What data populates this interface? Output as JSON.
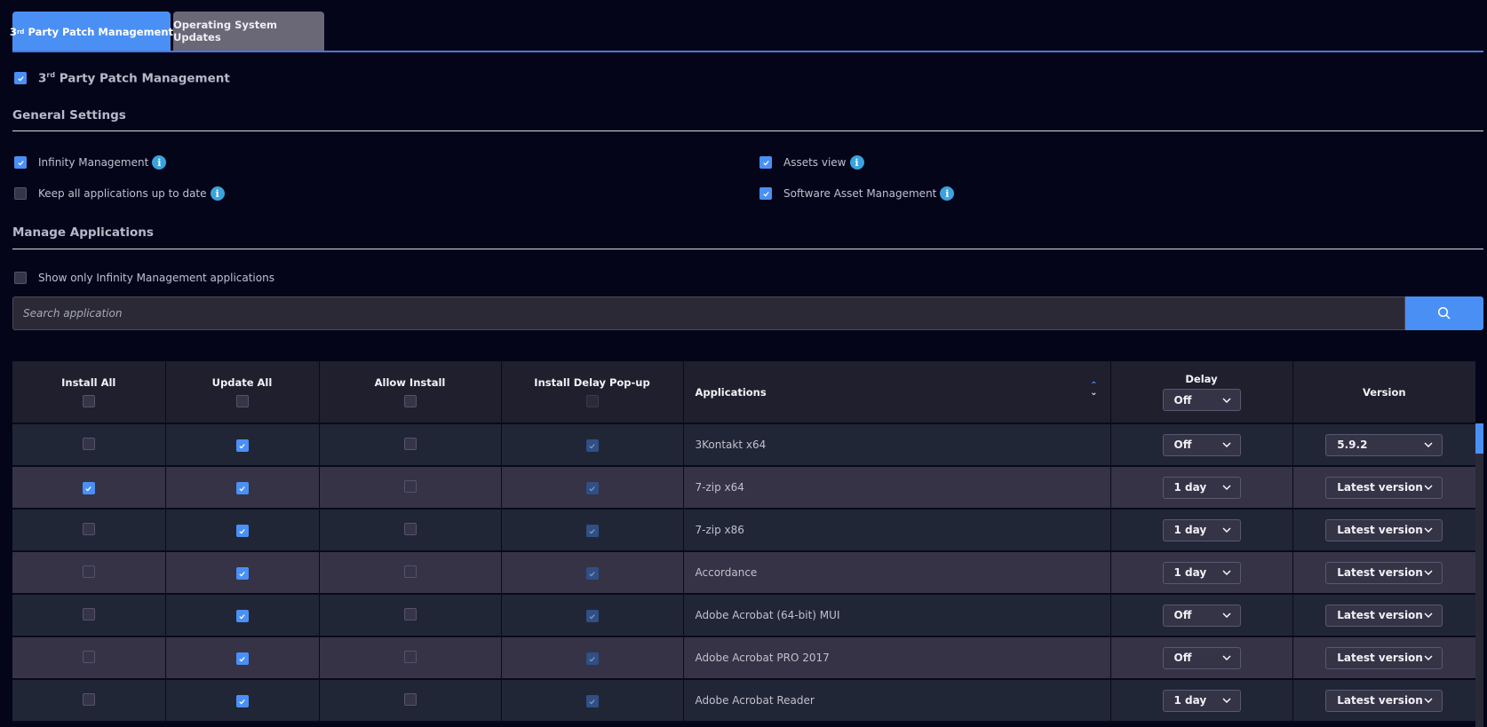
{
  "tabs": [
    {
      "label_main": "3",
      "label_sup": "rd",
      "label_rest": " Party Patch Management",
      "active": true
    },
    {
      "label": "Operating System Updates",
      "active": false
    }
  ],
  "master_toggle": {
    "prefix": "3",
    "sup": "rd",
    "rest": " Party Patch Management",
    "checked": true
  },
  "general_settings": {
    "title": "General Settings",
    "options": [
      {
        "label": "Infinity Management",
        "checked": true,
        "info": "info-icon"
      },
      {
        "label": "Keep all applications up to date",
        "checked": false,
        "info": "info-icon"
      },
      {
        "label": "Assets view",
        "checked": true,
        "info": "info-icon"
      },
      {
        "label": "Software Asset Management",
        "checked": true,
        "info": "info-icon"
      }
    ]
  },
  "manage_apps": {
    "title": "Manage Applications",
    "show_only_label": "Show only Infinity Management applications",
    "show_only_checked": false,
    "search_placeholder": "Search application",
    "search_icon": "search-icon"
  },
  "table": {
    "columns": [
      "Install All",
      "Update All",
      "Allow Install",
      "Install Delay Pop-up",
      "Applications",
      "Delay",
      "Version"
    ],
    "header_delay_value": "Off",
    "rows": [
      {
        "install": false,
        "update": true,
        "allow": false,
        "popup": true,
        "app": "3Kontakt x64",
        "delay": "Off",
        "version": "5.9.2"
      },
      {
        "install": true,
        "update": true,
        "allow": false,
        "popup": true,
        "app": "7-zip x64",
        "delay": "1 day",
        "version": "Latest version"
      },
      {
        "install": false,
        "update": true,
        "allow": false,
        "popup": true,
        "app": "7-zip x86",
        "delay": "1 day",
        "version": "Latest version"
      },
      {
        "install": false,
        "update": true,
        "allow": false,
        "popup": true,
        "app": "Accordance",
        "delay": "1 day",
        "version": "Latest version"
      },
      {
        "install": false,
        "update": true,
        "allow": false,
        "popup": true,
        "app": "Adobe Acrobat (64-bit) MUI",
        "delay": "Off",
        "version": "Latest version"
      },
      {
        "install": false,
        "update": true,
        "allow": false,
        "popup": true,
        "app": "Adobe Acrobat PRO 2017",
        "delay": "Off",
        "version": "Latest version"
      },
      {
        "install": false,
        "update": true,
        "allow": false,
        "popup": true,
        "app": "Adobe Acrobat Reader",
        "delay": "1 day",
        "version": "Latest version"
      }
    ]
  },
  "colors": {
    "accent": "#4a90f4",
    "background": "#05051a",
    "info": "#3aa3de"
  }
}
